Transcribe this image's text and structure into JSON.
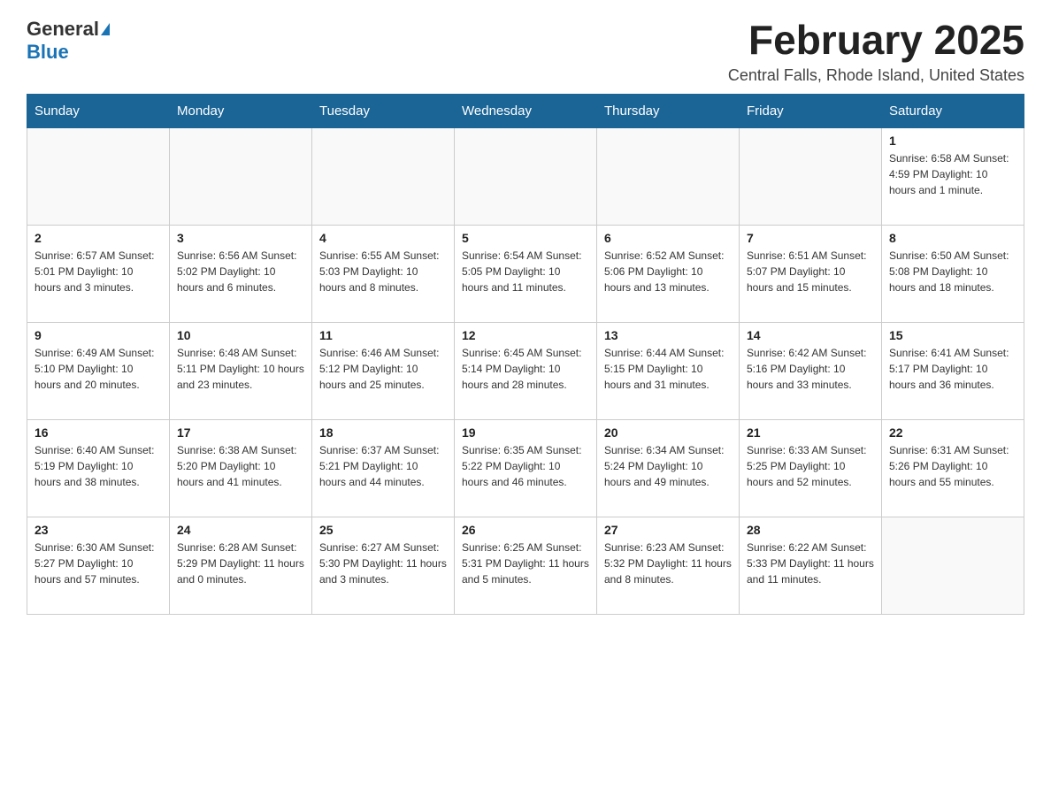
{
  "header": {
    "logo": {
      "general": "General",
      "blue": "Blue",
      "tagline": ""
    },
    "title": "February 2025",
    "subtitle": "Central Falls, Rhode Island, United States"
  },
  "calendar": {
    "days_of_week": [
      "Sunday",
      "Monday",
      "Tuesday",
      "Wednesday",
      "Thursday",
      "Friday",
      "Saturday"
    ],
    "weeks": [
      [
        {
          "day": "",
          "info": ""
        },
        {
          "day": "",
          "info": ""
        },
        {
          "day": "",
          "info": ""
        },
        {
          "day": "",
          "info": ""
        },
        {
          "day": "",
          "info": ""
        },
        {
          "day": "",
          "info": ""
        },
        {
          "day": "1",
          "info": "Sunrise: 6:58 AM\nSunset: 4:59 PM\nDaylight: 10 hours and 1 minute."
        }
      ],
      [
        {
          "day": "2",
          "info": "Sunrise: 6:57 AM\nSunset: 5:01 PM\nDaylight: 10 hours and 3 minutes."
        },
        {
          "day": "3",
          "info": "Sunrise: 6:56 AM\nSunset: 5:02 PM\nDaylight: 10 hours and 6 minutes."
        },
        {
          "day": "4",
          "info": "Sunrise: 6:55 AM\nSunset: 5:03 PM\nDaylight: 10 hours and 8 minutes."
        },
        {
          "day": "5",
          "info": "Sunrise: 6:54 AM\nSunset: 5:05 PM\nDaylight: 10 hours and 11 minutes."
        },
        {
          "day": "6",
          "info": "Sunrise: 6:52 AM\nSunset: 5:06 PM\nDaylight: 10 hours and 13 minutes."
        },
        {
          "day": "7",
          "info": "Sunrise: 6:51 AM\nSunset: 5:07 PM\nDaylight: 10 hours and 15 minutes."
        },
        {
          "day": "8",
          "info": "Sunrise: 6:50 AM\nSunset: 5:08 PM\nDaylight: 10 hours and 18 minutes."
        }
      ],
      [
        {
          "day": "9",
          "info": "Sunrise: 6:49 AM\nSunset: 5:10 PM\nDaylight: 10 hours and 20 minutes."
        },
        {
          "day": "10",
          "info": "Sunrise: 6:48 AM\nSunset: 5:11 PM\nDaylight: 10 hours and 23 minutes."
        },
        {
          "day": "11",
          "info": "Sunrise: 6:46 AM\nSunset: 5:12 PM\nDaylight: 10 hours and 25 minutes."
        },
        {
          "day": "12",
          "info": "Sunrise: 6:45 AM\nSunset: 5:14 PM\nDaylight: 10 hours and 28 minutes."
        },
        {
          "day": "13",
          "info": "Sunrise: 6:44 AM\nSunset: 5:15 PM\nDaylight: 10 hours and 31 minutes."
        },
        {
          "day": "14",
          "info": "Sunrise: 6:42 AM\nSunset: 5:16 PM\nDaylight: 10 hours and 33 minutes."
        },
        {
          "day": "15",
          "info": "Sunrise: 6:41 AM\nSunset: 5:17 PM\nDaylight: 10 hours and 36 minutes."
        }
      ],
      [
        {
          "day": "16",
          "info": "Sunrise: 6:40 AM\nSunset: 5:19 PM\nDaylight: 10 hours and 38 minutes."
        },
        {
          "day": "17",
          "info": "Sunrise: 6:38 AM\nSunset: 5:20 PM\nDaylight: 10 hours and 41 minutes."
        },
        {
          "day": "18",
          "info": "Sunrise: 6:37 AM\nSunset: 5:21 PM\nDaylight: 10 hours and 44 minutes."
        },
        {
          "day": "19",
          "info": "Sunrise: 6:35 AM\nSunset: 5:22 PM\nDaylight: 10 hours and 46 minutes."
        },
        {
          "day": "20",
          "info": "Sunrise: 6:34 AM\nSunset: 5:24 PM\nDaylight: 10 hours and 49 minutes."
        },
        {
          "day": "21",
          "info": "Sunrise: 6:33 AM\nSunset: 5:25 PM\nDaylight: 10 hours and 52 minutes."
        },
        {
          "day": "22",
          "info": "Sunrise: 6:31 AM\nSunset: 5:26 PM\nDaylight: 10 hours and 55 minutes."
        }
      ],
      [
        {
          "day": "23",
          "info": "Sunrise: 6:30 AM\nSunset: 5:27 PM\nDaylight: 10 hours and 57 minutes."
        },
        {
          "day": "24",
          "info": "Sunrise: 6:28 AM\nSunset: 5:29 PM\nDaylight: 11 hours and 0 minutes."
        },
        {
          "day": "25",
          "info": "Sunrise: 6:27 AM\nSunset: 5:30 PM\nDaylight: 11 hours and 3 minutes."
        },
        {
          "day": "26",
          "info": "Sunrise: 6:25 AM\nSunset: 5:31 PM\nDaylight: 11 hours and 5 minutes."
        },
        {
          "day": "27",
          "info": "Sunrise: 6:23 AM\nSunset: 5:32 PM\nDaylight: 11 hours and 8 minutes."
        },
        {
          "day": "28",
          "info": "Sunrise: 6:22 AM\nSunset: 5:33 PM\nDaylight: 11 hours and 11 minutes."
        },
        {
          "day": "",
          "info": ""
        }
      ]
    ]
  }
}
